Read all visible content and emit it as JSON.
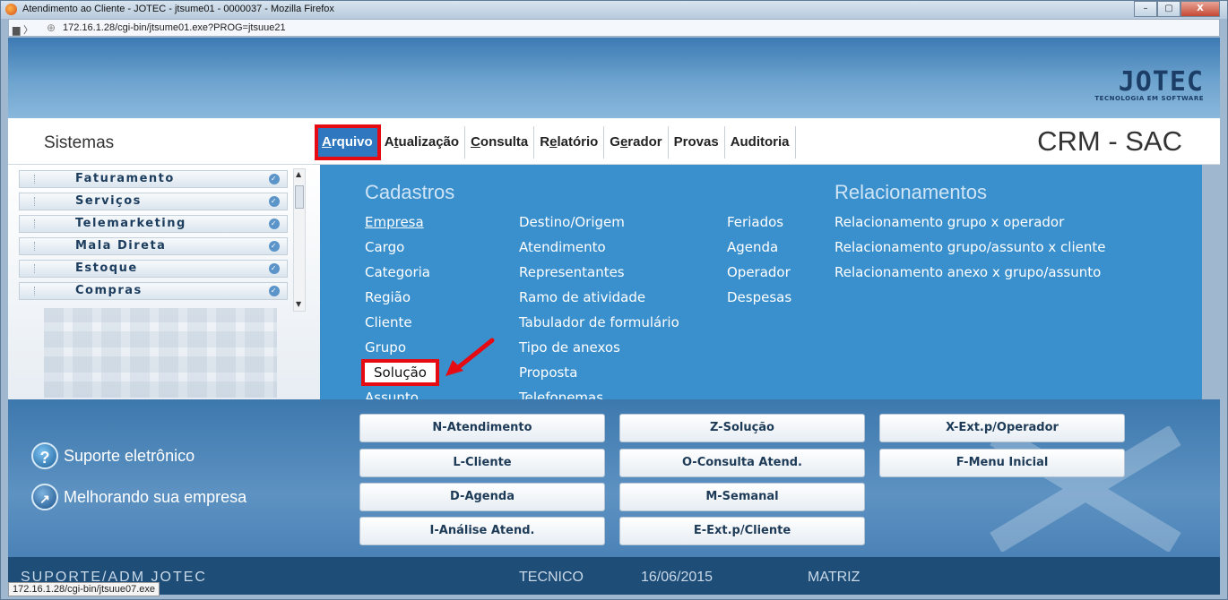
{
  "window": {
    "title": "Atendimento ao Cliente - JOTEC - jtsume01 - 0000037 - Mozilla Firefox",
    "url": "172.16.1.28/cgi-bin/jtsume01.exe?PROG=jtsuue21",
    "minimize": "–",
    "maximize": "▢",
    "close": "X"
  },
  "logo": {
    "text": "JOTEC",
    "subtitle": "TECNOLOGIA EM SOFTWARE"
  },
  "header": {
    "sistemas": "Sistemas",
    "app_title": "CRM - SAC",
    "menu": [
      {
        "pre": "",
        "key": "A",
        "post": "rquivo"
      },
      {
        "pre": "A",
        "key": "t",
        "post": "ualização"
      },
      {
        "pre": "",
        "key": "C",
        "post": "onsulta"
      },
      {
        "pre": "R",
        "key": "e",
        "post": "latório"
      },
      {
        "pre": "G",
        "key": "e",
        "post": "rador"
      },
      {
        "pre": "Provas",
        "key": "",
        "post": ""
      },
      {
        "pre": "Auditoria",
        "key": "",
        "post": ""
      }
    ]
  },
  "sidebar": {
    "items": [
      "Faturamento",
      "Serviços",
      "Telemarketing",
      "Mala Direta",
      "Estoque",
      "Compras"
    ]
  },
  "dropdown": {
    "cadastros_heading": "Cadastros",
    "relacionamentos_heading": "Relacionamentos",
    "col1": [
      "Empresa",
      "Cargo",
      "Categoria",
      "Região",
      "Cliente",
      "Grupo",
      "Solução",
      "Assunto"
    ],
    "col2": [
      "Destino/Origem",
      "Atendimento",
      "Representantes",
      "Ramo de atividade",
      "Tabulador de formulário",
      "Tipo de anexos",
      "Proposta",
      "Telefonemas"
    ],
    "col3": [
      "Feriados",
      "Agenda",
      "Operador",
      "Despesas"
    ],
    "col4": [
      "Relacionamento grupo x operador",
      "Relacionamento grupo/assunto x cliente",
      "Relacionamento anexo x grupo/assunto"
    ]
  },
  "bottom": {
    "support1": "Suporte eletrônico",
    "support2": "Melhorando sua empresa",
    "buttons": [
      "N-Atendimento",
      "Z-Solução",
      "X-Ext.p/Operador",
      "L-Cliente",
      "O-Consulta Atend.",
      "F-Menu Inicial",
      "D-Agenda",
      "M-Semanal",
      "I-Análise Atend.",
      "E-Ext.p/Cliente"
    ]
  },
  "status": {
    "company": "SUPORTE/ADM JOTEC",
    "user": "TECNICO",
    "date": "16/06/2015",
    "branch": "MATRIZ",
    "link_tooltip": "172.16.1.28/cgi-bin/jtsuue07.exe"
  },
  "colors": {
    "dropdown_bg": "#3a8fcd",
    "highlight_box": "#e60a12",
    "active_menu": "#2f77bf",
    "status_bg": "#1e4d77"
  }
}
